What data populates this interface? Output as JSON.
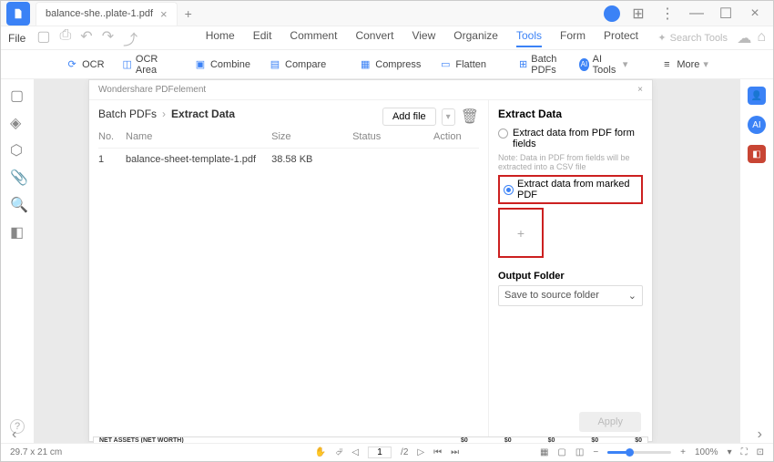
{
  "titlebar": {
    "tab_name": "balance-she..plate-1.pdf"
  },
  "filebar": {
    "file_label": "File",
    "tabs": [
      "Home",
      "Edit",
      "Comment",
      "Convert",
      "View",
      "Organize",
      "Tools",
      "Form",
      "Protect"
    ],
    "search_placeholder": "Search Tools"
  },
  "toolbar": {
    "ocr": "OCR",
    "ocr_area": "OCR Area",
    "combine": "Combine",
    "compare": "Compare",
    "compress": "Compress",
    "flatten": "Flatten",
    "batch_pdfs": "Batch PDFs",
    "ai_tools": "AI Tools",
    "more": "More"
  },
  "panel": {
    "app_name": "Wondershare PDFelement",
    "breadcrumb_root": "Batch PDFs",
    "breadcrumb_current": "Extract Data",
    "add_file": "Add file",
    "columns": {
      "no": "No.",
      "name": "Name",
      "size": "Size",
      "status": "Status",
      "action": "Action"
    },
    "rows": [
      {
        "no": "1",
        "name": "balance-sheet-template-1.pdf",
        "size": "38.58 KB",
        "status": "",
        "action": ""
      }
    ],
    "extract_title": "Extract Data",
    "opt_form_fields": "Extract data from PDF form fields",
    "note": "Note: Data in PDF from fields will be extracted into a CSV file",
    "opt_marked": "Extract data from marked PDF",
    "output_label": "Output Folder",
    "output_value": "Save to source folder",
    "apply": "Apply"
  },
  "doc_strip": {
    "left": "NET ASSETS (NET WORTH)",
    "v1": "$0",
    "v2": "$0",
    "v3": "$0",
    "v4": "$0",
    "v5": "$0"
  },
  "statusbar": {
    "dimensions": "29.7 x 21 cm",
    "page_current": "1",
    "page_total": "/2",
    "zoom": "100%"
  }
}
